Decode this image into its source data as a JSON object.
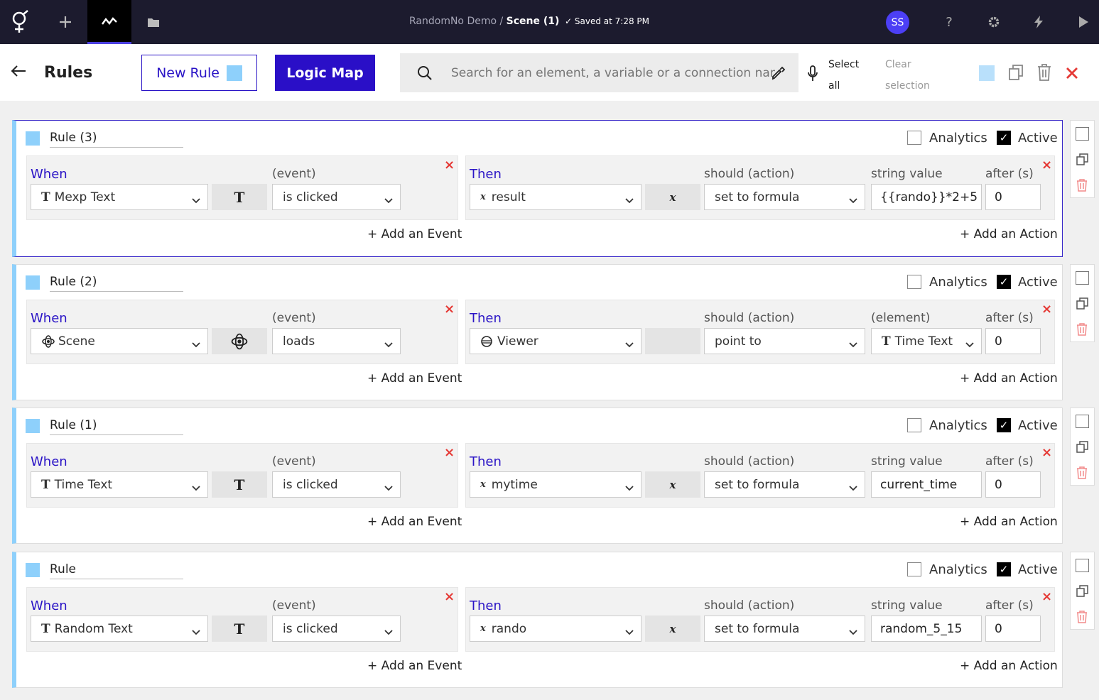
{
  "topbar": {
    "breadcrumb_project": "RandomNo Demo /",
    "breadcrumb_scene": "Scene (1)",
    "saved_status": "Saved at 7:28 PM",
    "avatar_initials": "SS",
    "help": "?"
  },
  "header": {
    "title": "Rules",
    "new_rule_label": "New Rule",
    "logic_map_label": "Logic Map",
    "search_placeholder": "Search for an element, a variable or a connection name",
    "select_all_label": "Select all",
    "clear_selection_label": "Clear selection"
  },
  "colors": {
    "accent": "#2a0fc7",
    "rule_swatch": "#8ed0fb",
    "danger": "#e53935",
    "topbar": "#1c1b2e"
  },
  "common": {
    "analytics": "Analytics",
    "active": "Active",
    "when": "When",
    "event_col": "(event)",
    "then": "Then",
    "action_col": "should (action)",
    "after_col": "after (s)",
    "add_event": "+ Add an Event",
    "add_action": "+ Add an Action"
  },
  "rules": [
    {
      "name": "Rule (3)",
      "analytics": false,
      "active": true,
      "when_element": "Mexp Text",
      "when_icon": "text-icon",
      "event": "is clicked",
      "then_target": "result",
      "then_icon": "variable-icon",
      "action": "set to formula",
      "value_col": "string value",
      "value": "{{rando}}*2+5",
      "after": "0"
    },
    {
      "name": "Rule (2)",
      "analytics": false,
      "active": true,
      "when_element": "Scene",
      "when_icon": "scene-icon",
      "event": "loads",
      "then_target": "Viewer",
      "then_icon": "viewer-icon",
      "action": "point to",
      "value_col": "(element)",
      "value": "Time Text",
      "after": "0"
    },
    {
      "name": "Rule (1)",
      "analytics": false,
      "active": true,
      "when_element": "Time Text",
      "when_icon": "text-icon",
      "event": "is clicked",
      "then_target": "mytime",
      "then_icon": "variable-icon",
      "action": "set to formula",
      "value_col": "string value",
      "value": "current_time",
      "after": "0"
    },
    {
      "name": "Rule",
      "analytics": false,
      "active": true,
      "when_element": "Random Text",
      "when_icon": "text-icon",
      "event": "is clicked",
      "then_target": "rando",
      "then_icon": "variable-icon",
      "action": "set to formula",
      "value_col": "string value",
      "value": "random_5_15",
      "after": "0"
    }
  ]
}
